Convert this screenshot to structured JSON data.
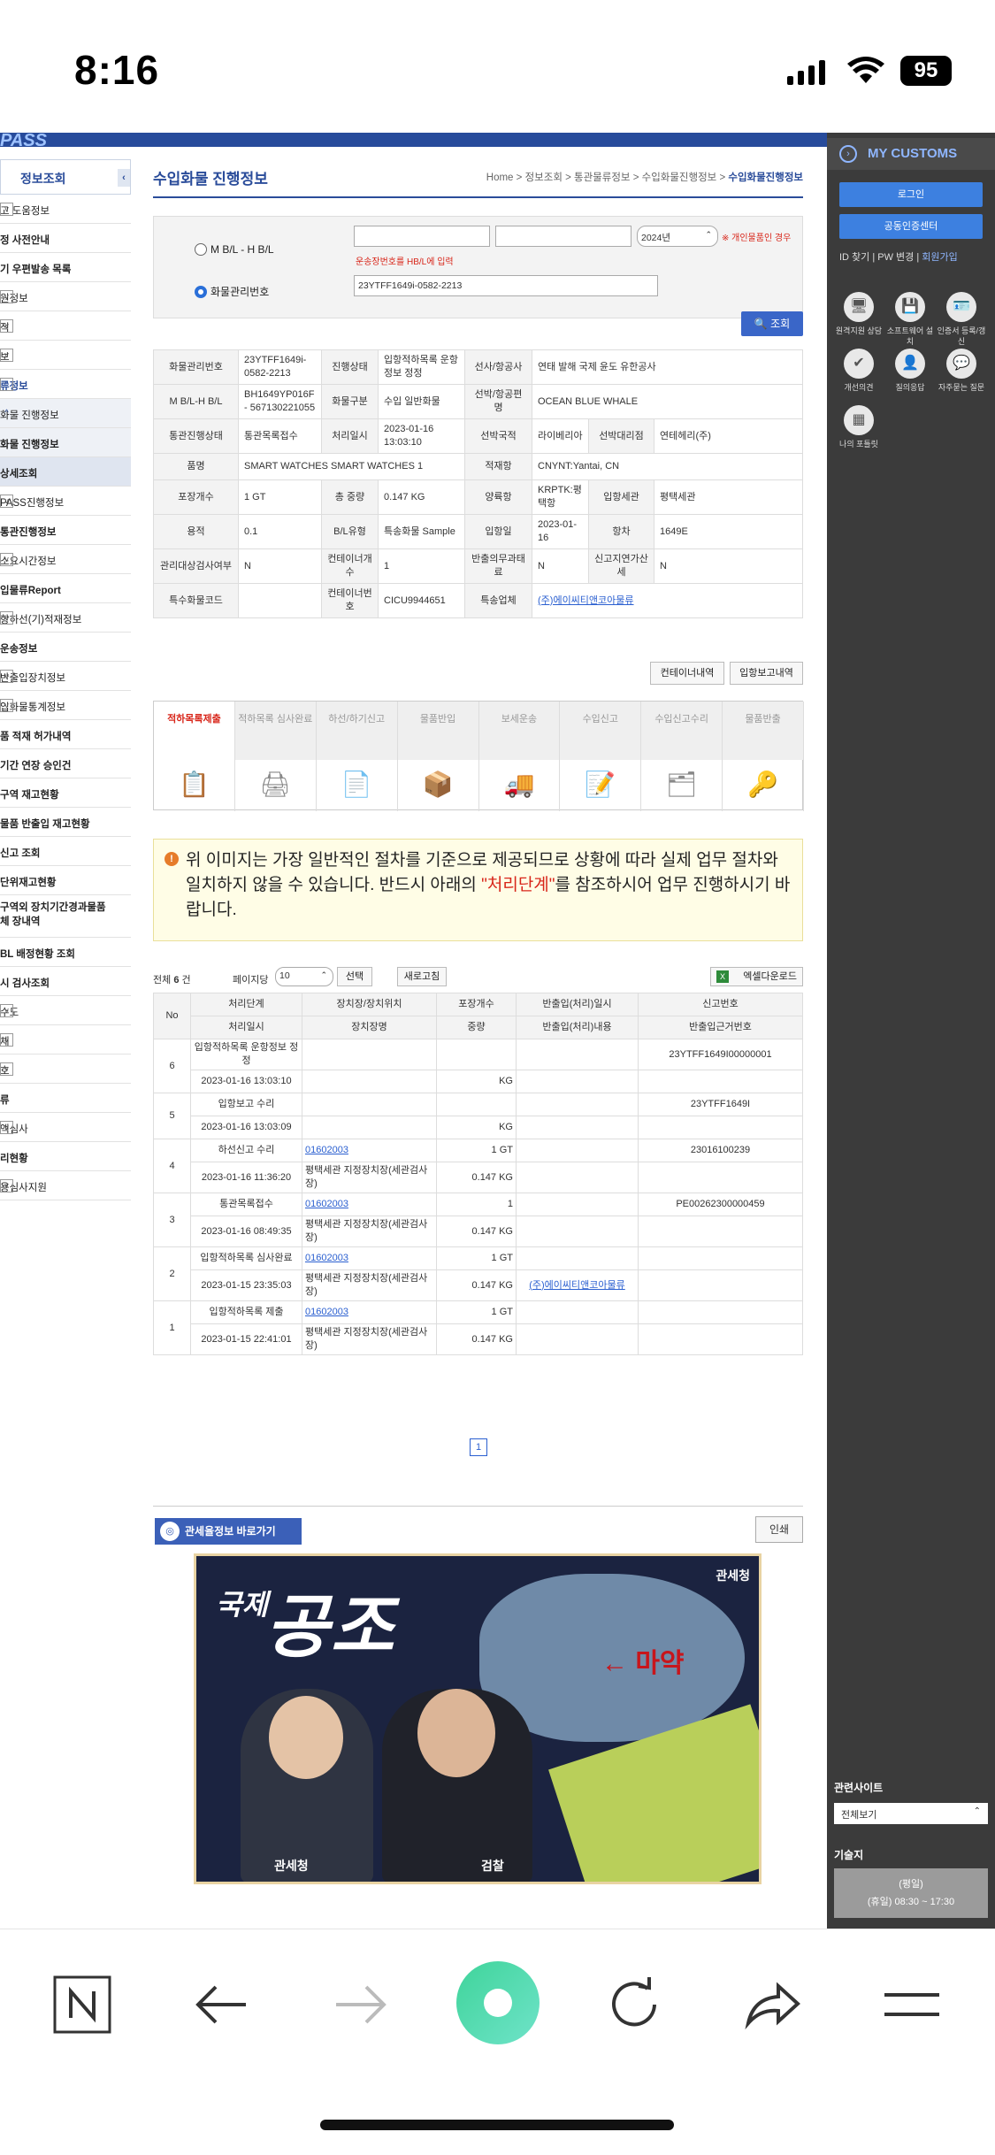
{
  "status_bar": {
    "time": "8:16",
    "battery": "95"
  },
  "top_bar": {
    "logo": "PASS"
  },
  "left_nav": {
    "header": "정보조회",
    "items": [
      {
        "label": "고 도움정보",
        "toggle": "v"
      },
      {
        "label": "정 사전안내",
        "toggle": ""
      },
      {
        "label": "기 우편발송 목록",
        "toggle": ""
      },
      {
        "label": "원정보",
        "toggle": "v"
      },
      {
        "label": "적",
        "toggle": "v"
      },
      {
        "label": "보",
        "toggle": "v"
      },
      {
        "label": "류정보",
        "toggle": "^"
      },
      {
        "label": "화물 진행정보",
        "toggle": "^"
      },
      {
        "label": "화물 진행정보",
        "toggle": ""
      },
      {
        "label": "상세조회",
        "toggle": ""
      },
      {
        "label": "PASS진행정보",
        "toggle": "v"
      },
      {
        "label": "통관진행정보",
        "toggle": ""
      },
      {
        "label": "소요시간정보",
        "toggle": "v"
      },
      {
        "label": "입물류Report",
        "toggle": ""
      },
      {
        "label": "항하선(기)적재정보",
        "toggle": "v"
      },
      {
        "label": "운송정보",
        "toggle": ""
      },
      {
        "label": "반출입장치정보",
        "toggle": "v"
      },
      {
        "label": "입화물통계정보",
        "toggle": "v"
      },
      {
        "label": "품 적재 허가내역",
        "toggle": ""
      },
      {
        "label": "기간 연장 승인건",
        "toggle": ""
      },
      {
        "label": "구역 재고현황",
        "toggle": ""
      },
      {
        "label": "물품 반출입 재고현황",
        "toggle": ""
      },
      {
        "label": "신고 조회",
        "toggle": ""
      },
      {
        "label": "단위재고현황",
        "toggle": ""
      },
      {
        "label": "구역외 장치기간경과물품 체 장내역",
        "toggle": ""
      },
      {
        "label": "BL 배정현황 조회",
        "toggle": ""
      },
      {
        "label": "시 검사조회",
        "toggle": ""
      },
      {
        "label": "수도",
        "toggle": "v"
      },
      {
        "label": "체",
        "toggle": "v"
      },
      {
        "label": "호",
        "toggle": "v"
      },
      {
        "label": "류",
        "toggle": ""
      },
      {
        "label": "액심사",
        "toggle": "v"
      },
      {
        "label": "리현황",
        "toggle": ""
      },
      {
        "label": "용심사지원",
        "toggle": "v"
      }
    ]
  },
  "main": {
    "title": "수입화물 진행정보",
    "breadcrumb": [
      "Home",
      "정보조회",
      "통관물류정보",
      "수입화물진행정보",
      "수입화물진행정보"
    ],
    "search": {
      "radio_mbl": "M B/L - H B/L",
      "radio_cargo": "화물관리번호",
      "mbl_value": "",
      "hbl_value": "",
      "year": "2024년",
      "personal_note": "※ 개인물품인 경우",
      "hint": "운송장번호를 HB/L에 입력",
      "cargo_no": "23YTFF1649i-0582-2213",
      "search_button": "조회"
    },
    "info": {
      "cargo_no_label": "화물관리번호",
      "cargo_no": "23YTFF1649i-0582-2213",
      "status_label": "진행상태",
      "status": "입항적하목록 운항정보 정정",
      "carrier_label": "선사/항공사",
      "carrier": "연태 발해 국제 윤도 유한공사",
      "mbl_label": "M B/L-H B/L",
      "mbl": "BH1649YP016F - 567130221055",
      "cargo_type_label": "화물구분",
      "cargo_type": "수입 일반화물",
      "vessel_label": "선박/항공편명",
      "vessel": "OCEAN BLUE WHALE",
      "clearance_label": "통관진행상태",
      "clearance": "통관목록접수",
      "proc_time_label": "처리일시",
      "proc_time": "2023-01-16 13:03:10",
      "nation_label": "선박국적",
      "nation": "라이베리아",
      "agent_label": "선박대리점",
      "agent": "연테헤리(주)",
      "item_label": "품명",
      "item": "SMART WATCHES SMART WATCHES 1",
      "load_port_label": "적재항",
      "load_port": "CNYNT:Yantai, CN",
      "pkg_label": "포장개수",
      "pkg": "1 GT",
      "weight_label": "총 중량",
      "weight": "0.147 KG",
      "unload_port_label": "양륙항",
      "unload_port": "KRPTK:평택항",
      "customs_label": "입항세관",
      "customs": "평택세관",
      "volume_label": "용적",
      "volume": "0.1",
      "bl_type_label": "B/L유형",
      "bl_type": "특송화물 Sample",
      "arrival_label": "입항일",
      "arrival": "2023-01-16",
      "voyage_label": "항차",
      "voyage": "1649E",
      "mgmt_label": "관리대상검사여부",
      "mgmt": "N",
      "cntr_cnt_label": "컨테이너개수",
      "cntr_cnt": "1",
      "export_label": "반출의무과태료",
      "export": "N",
      "late_label": "신고지연가산세",
      "late": "N",
      "special_label": "특수화물코드",
      "special": "",
      "cntr_no_label": "컨테이너번호",
      "cntr_no": "CICU9944651",
      "courier_label": "특송업체",
      "courier": "(주)에이씨티앤코아물류"
    },
    "container_button": "컨테이너내역",
    "arrival_button": "입항보고내역",
    "steps": [
      {
        "label": "적하목록제출",
        "icon": "📋",
        "active": true
      },
      {
        "label": "적하목록 심사완료",
        "icon": "🖨",
        "active": false
      },
      {
        "label": "하선/하기신고",
        "icon": "📄",
        "active": false
      },
      {
        "label": "물품반입",
        "icon": "📦",
        "active": false
      },
      {
        "label": "보세운송",
        "icon": "🚚",
        "active": false
      },
      {
        "label": "수입신고",
        "icon": "📝",
        "active": false
      },
      {
        "label": "수입신고수리",
        "icon": "🗂",
        "active": false
      },
      {
        "label": "물품반출",
        "icon": "🔑",
        "active": false
      }
    ],
    "notice": {
      "text1": "위 이미지는 가장 일반적인 절차를 기준으로 제공되므로 상황에 따라 실제 업무 절차와 일치하지 않을 수 있습니다. 반드시 아래의 ",
      "highlight": "\"처리단계\"",
      "text2": "를 참조하시어 업무 진행하시기 바랍니다."
    },
    "list_bar": {
      "total_prefix": "전체",
      "total": "6",
      "total_suffix": "건",
      "per_page_label": "페이지당",
      "per_page": "10",
      "select_button": "선택",
      "refresh_button": "새로고침",
      "excel_button": "엑셀다운로드"
    },
    "history_headers": {
      "no": "No",
      "step": "처리단계",
      "step_time": "처리일시",
      "location": "장치장/장치위치",
      "location_name": "장치장명",
      "pkg": "포장개수",
      "weight": "중량",
      "io_time": "반출입(처리)일시",
      "io_desc": "반출입(처리)내용",
      "report_no": "신고번호",
      "basis_no": "반출입근거번호"
    },
    "history": [
      {
        "no": "6",
        "step": "입항적하목록 운항정보 정정",
        "time": "2023-01-16 13:03:10",
        "loc": "",
        "loc_name": "",
        "pkg": "",
        "weight": "KG",
        "io_time": "",
        "io_desc": "",
        "report": "23YTFF1649I00000001",
        "basis": ""
      },
      {
        "no": "5",
        "step": "입항보고 수리",
        "time": "2023-01-16 13:03:09",
        "loc": "",
        "loc_name": "",
        "pkg": "",
        "weight": "KG",
        "io_time": "",
        "io_desc": "",
        "report": "23YTFF1649I",
        "basis": ""
      },
      {
        "no": "4",
        "step": "하선신고 수리",
        "time": "2023-01-16 11:36:20",
        "loc": "01602003",
        "loc_name": "평택세관 지정장치장(세관검사장)",
        "pkg": "1 GT",
        "weight": "0.147 KG",
        "io_time": "",
        "io_desc": "",
        "report": "23016100239",
        "basis": ""
      },
      {
        "no": "3",
        "step": "통관목록접수",
        "time": "2023-01-16 08:49:35",
        "loc": "01602003",
        "loc_name": "평택세관 지정장치장(세관검사장)",
        "pkg": "1",
        "weight": "0.147 KG",
        "io_time": "",
        "io_desc": "",
        "report": "PE00262300000459",
        "basis": ""
      },
      {
        "no": "2",
        "step": "입항적하목록 심사완료",
        "time": "2023-01-15 23:35:03",
        "loc": "01602003",
        "loc_name": "평택세관 지정장치장(세관검사장)",
        "pkg": "1 GT",
        "weight": "0.147 KG",
        "io_time": "",
        "io_desc": "(주)에이씨티앤코아물류",
        "report": "",
        "basis": ""
      },
      {
        "no": "1",
        "step": "입항적하목록 제출",
        "time": "2023-01-15 22:41:01",
        "loc": "01602003",
        "loc_name": "평택세관 지정장치장(세관검사장)",
        "pkg": "1 GT",
        "weight": "0.147 KG",
        "io_time": "",
        "io_desc": "",
        "report": "",
        "basis": ""
      }
    ],
    "page": "1",
    "customs_law_button": "관세율정보 바로가기",
    "print_button": "인쇄",
    "banner": {
      "t1": "국제",
      "t2": "공조",
      "logo": "관세청",
      "drug": "← 마약",
      "label1": "관세청",
      "label2": "검찰"
    }
  },
  "right_panel": {
    "title": "MY CUSTOMS",
    "login": "로그인",
    "cert": "공동인증센터",
    "id_find": "ID 찾기",
    "pw_change": "PW 변경",
    "join": "회원가입",
    "icons": [
      {
        "label": "원격지원 상담",
        "icon": "🖥"
      },
      {
        "label": "소프트웨어 설치",
        "icon": "💾"
      },
      {
        "label": "인증서 등록/갱신",
        "icon": "🪪"
      },
      {
        "label": "개선의견",
        "icon": "✔"
      },
      {
        "label": "질의응답",
        "icon": "👤"
      },
      {
        "label": "자주묻는 질문",
        "icon": "💬"
      },
      {
        "label": "나의 포틀릿",
        "icon": "▦"
      }
    ],
    "related": "관련사이트",
    "related_select": "전체보기",
    "tech": "기술지",
    "hours1": "(평일)",
    "hours2": "(휴일) 08:30 ~ 17:30"
  }
}
